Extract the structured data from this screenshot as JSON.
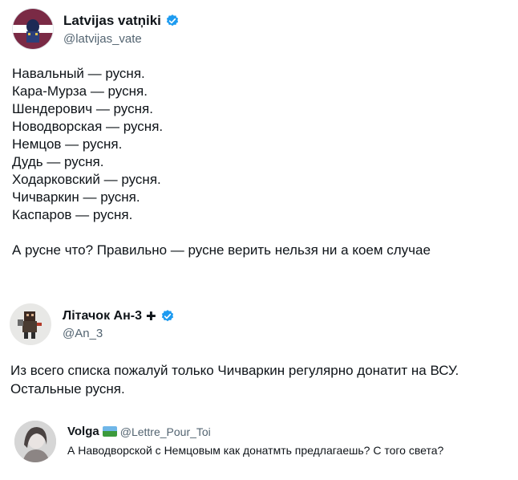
{
  "post1": {
    "author_name": "Latvijas vatņiki",
    "handle": "@latvijas_vate",
    "text": "Навальный — русня.\nКара-Мурза — русня.\nШендерович — русня.\nНоводворская — русня.\nНемцов — русня.\nДудь — русня.\nХодарковский — русня.\nЧичваркин — русня.\nКаспаров — русня.",
    "text2": "А русне что? Правильно — русне верить нельзя ни а коем случае"
  },
  "post2": {
    "author_name": "Літачок Ан-3",
    "name_symbol": "✚",
    "handle": "@An_3",
    "text": "Из всего списка пожалуй только Чичваркин регулярно донатит на ВСУ.\nОстальные русня."
  },
  "reply": {
    "author_name": "Volga",
    "handle": "@Lettre_Pour_Toi",
    "text": "А Наводворской с Немцовым как донатмть предлагаешь? С того света?"
  },
  "colors": {
    "verified": "#1d9bf0",
    "handle": "#536471",
    "text": "#0f1419"
  },
  "icons": [
    "verified-badge-icon",
    "flag-emoji-icon"
  ]
}
